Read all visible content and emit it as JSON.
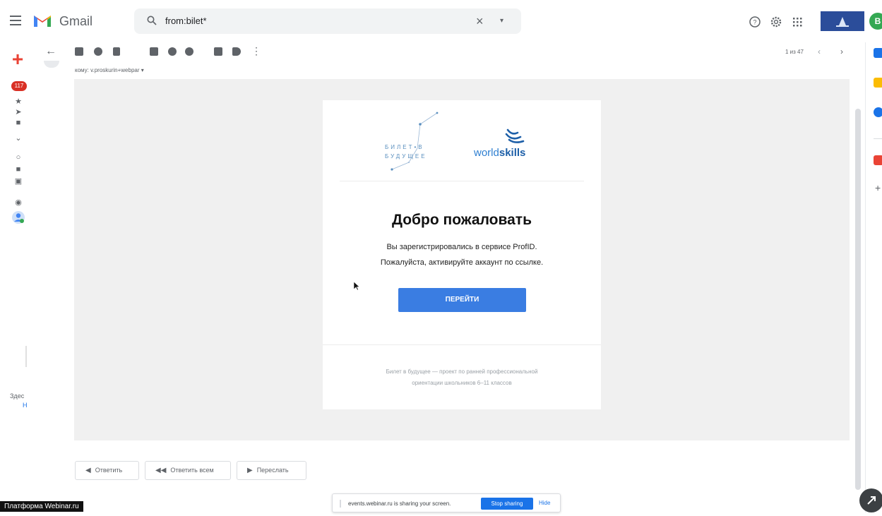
{
  "header": {
    "app_name": "Gmail",
    "search": {
      "query": "from:bilet*"
    }
  },
  "left_rail": {
    "inbox_count": "117",
    "bottom_text_1": "Здес",
    "bottom_text_2": "Н"
  },
  "toolbar": {
    "pagination": "1 из 47"
  },
  "message": {
    "recipient_line": "кому: v.proskurin+webpar ▾",
    "brand_logo_line_1": "БИЛЕТ•В",
    "brand_logo_line_2": "БУДУЩЕЕ",
    "partner_logo_text_light": "world",
    "partner_logo_text_bold": "skills",
    "title": "Добро пожаловать",
    "line_1": "Вы зарегистрировались в сервисе ProfID.",
    "line_2": "Пожалуйста, активируйте аккаунт по ссылке.",
    "button_label": "ПЕРЕЙТИ",
    "footer_line_1": "Билет в будущее — проект по ранней профессиональной",
    "footer_line_2": "ориентации школьников 6–11 классов"
  },
  "reply_actions": {
    "reply": "Ответить",
    "reply_all": "Ответить всем",
    "forward": "Переслать"
  },
  "overlays": {
    "webinar_label": "Платформа Webinar.ru",
    "share_text": "events.webinar.ru is sharing your screen.",
    "stop_sharing": "Stop sharing",
    "hide": "Hide"
  },
  "colors": {
    "accent_blue": "#3a7de2",
    "gmail_red": "#ea4335",
    "badge_red": "#d93025",
    "avatar_green": "#34a853"
  }
}
